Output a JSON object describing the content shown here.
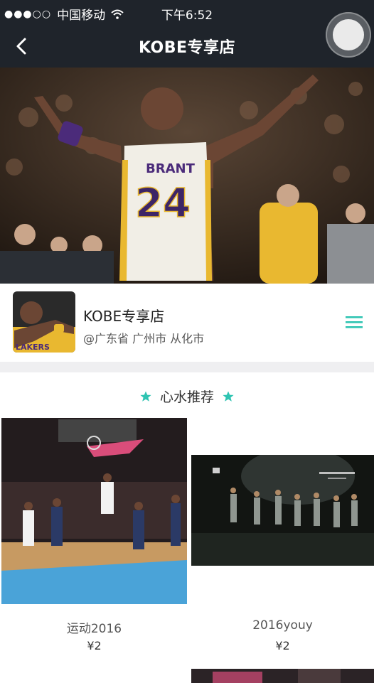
{
  "status_bar": {
    "signal": "●●●○○",
    "carrier": "中国移动",
    "time": "下午6:52"
  },
  "nav": {
    "title": "KOBE专享店",
    "back_icon": "chevron-left-icon"
  },
  "shop": {
    "name": "KOBE专享店",
    "location": "@广东省 广州市 从化市",
    "menu_icon": "hamburger-menu-icon"
  },
  "recommend": {
    "title": "心水推荐",
    "star_color": "#2fc4b2"
  },
  "products": [
    {
      "name": "运动2016",
      "price": "¥2"
    },
    {
      "name": "2016youy",
      "price": "¥2"
    }
  ],
  "colors": {
    "nav_bg": "#1f242b",
    "accent": "#2fc4b2"
  }
}
